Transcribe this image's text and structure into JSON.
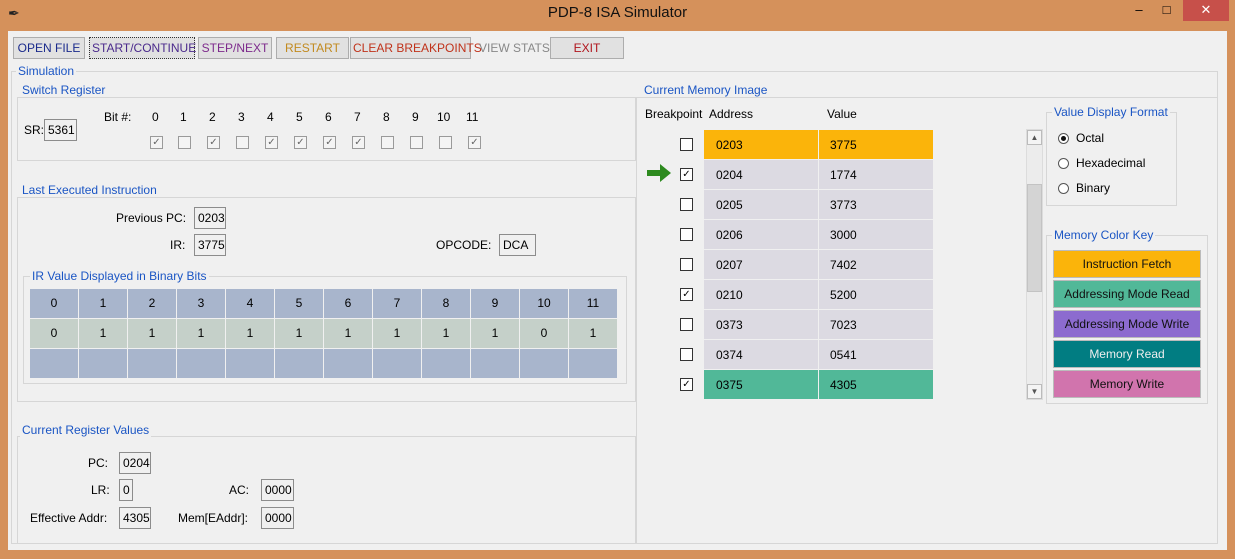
{
  "window": {
    "title": "PDP-8 ISA Simulator",
    "min": "–",
    "max": "□",
    "close": "✕"
  },
  "toolbar": {
    "open": "OPEN FILE",
    "start": "START/CONTINUE",
    "step": "STEP/NEXT",
    "restart": "RESTART",
    "clear": "CLEAR BREAKPOINTS",
    "stats": "VIEW STATS",
    "exit": "EXIT"
  },
  "colors": {
    "open": "#1a2a8c",
    "start": "#4b2a8c",
    "step": "#7d2a8c",
    "restart": "#c28a1f",
    "clear": "#c0321a",
    "stats": "#888888",
    "exit": "#b0151d"
  },
  "simulation": {
    "label": "Simulation",
    "switch_register": {
      "label": "Switch Register",
      "sr_label": "SR:",
      "sr_value": "5361",
      "bit_label": "Bit #:",
      "bits": [
        "0",
        "1",
        "2",
        "3",
        "4",
        "5",
        "6",
        "7",
        "8",
        "9",
        "10",
        "11"
      ],
      "checked": [
        true,
        false,
        true,
        false,
        true,
        true,
        true,
        true,
        false,
        false,
        false,
        true
      ]
    },
    "last_instruction": {
      "label": "Last Executed Instruction",
      "prev_pc_label": "Previous PC:",
      "prev_pc": "0203",
      "ir_label": "IR:",
      "ir": "3775",
      "opcode_label": "OPCODE:",
      "opcode": "DCA",
      "binary_label": "IR Value Displayed in Binary Bits",
      "bit_headers": [
        "0",
        "1",
        "2",
        "3",
        "4",
        "5",
        "6",
        "7",
        "8",
        "9",
        "10",
        "11"
      ],
      "bit_values": [
        "0",
        "1",
        "1",
        "1",
        "1",
        "1",
        "1",
        "1",
        "1",
        "1",
        "0",
        "1"
      ]
    },
    "registers": {
      "label": "Current Register Values",
      "pc_label": "PC:",
      "pc": "0204",
      "lr_label": "LR:",
      "lr": "0",
      "ac_label": "AC:",
      "ac": "0000",
      "ea_label": "Effective Addr:",
      "ea": "4305",
      "mem_label": "Mem[EAddr]:",
      "mem": "0000"
    }
  },
  "memory": {
    "label": "Current Memory Image",
    "col_breakpoint": "Breakpoint",
    "col_address": "Address",
    "col_value": "Value",
    "rows": [
      {
        "address": "0203",
        "value": "3775",
        "bp": false,
        "color": "#fbb40a",
        "current": false
      },
      {
        "address": "0204",
        "value": "1774",
        "bp": true,
        "color": "#dcdae2",
        "current": true
      },
      {
        "address": "0205",
        "value": "3773",
        "bp": false,
        "color": "#dcdae2",
        "current": false
      },
      {
        "address": "0206",
        "value": "3000",
        "bp": false,
        "color": "#dcdae2",
        "current": false
      },
      {
        "address": "0207",
        "value": "7402",
        "bp": false,
        "color": "#dcdae2",
        "current": false
      },
      {
        "address": "0210",
        "value": "5200",
        "bp": true,
        "color": "#dcdae2",
        "current": false
      },
      {
        "address": "0373",
        "value": "7023",
        "bp": false,
        "color": "#dcdae2",
        "current": false
      },
      {
        "address": "0374",
        "value": "0541",
        "bp": false,
        "color": "#dcdae2",
        "current": false
      },
      {
        "address": "0375",
        "value": "4305",
        "bp": true,
        "color": "#51b898",
        "current": false
      }
    ],
    "format": {
      "label": "Value Display Format",
      "options": [
        "Octal",
        "Hexadecimal",
        "Binary"
      ],
      "selected": "Octal"
    },
    "color_key": {
      "label": "Memory Color Key",
      "items": [
        {
          "label": "Instruction Fetch",
          "color": "#fbb40a"
        },
        {
          "label": "Addressing Mode Read",
          "color": "#51b898"
        },
        {
          "label": "Addressing Mode Write",
          "color": "#8c6bcf"
        },
        {
          "label": "Memory Read",
          "color": "#017d82"
        },
        {
          "label": "Memory Write",
          "color": "#d174ad"
        }
      ]
    }
  }
}
